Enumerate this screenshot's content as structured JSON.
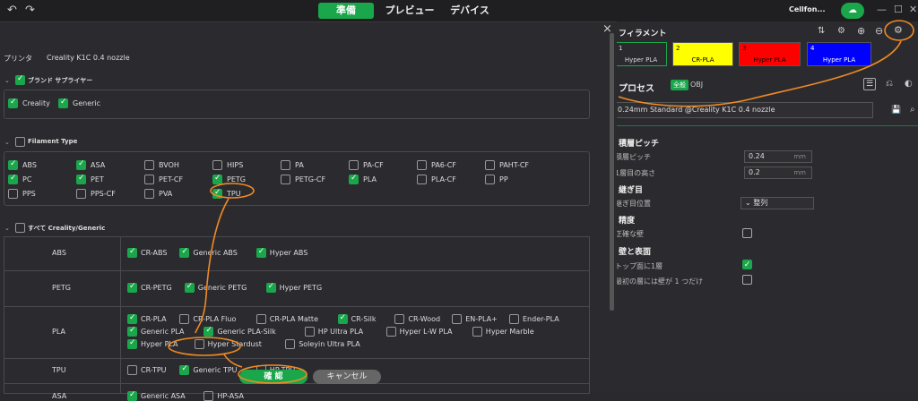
{
  "topbar": {
    "tabs": [
      "準備",
      "プレビュー",
      "デバイス"
    ],
    "user": "Cellfon..."
  },
  "right": {
    "filament_title": "フィラメント",
    "filaments": [
      {
        "num": "1",
        "name": "Hyper PLA",
        "color": "#2b2b2f"
      },
      {
        "num": "2",
        "name": "CR-PLA",
        "color": "#ffff00"
      },
      {
        "num": "3",
        "name": "Hyper PLA",
        "color": "#ff0000"
      },
      {
        "num": "4",
        "name": "Hyper PLA",
        "color": "#0000ff"
      }
    ],
    "process_title": "プロセス",
    "process_tag": "全般",
    "process_obj": "OBJ",
    "preset": "0.24mm Standard @Creality K1C 0.4 nozzle",
    "layer_pitch_title": "積層ピッチ",
    "layer_height_label": "積層ピッチ",
    "layer_height_value": "0.24",
    "first_layer_label": "1層目の高さ",
    "first_layer_value": "0.2",
    "unit": "mm",
    "seam_title": "継ぎ目",
    "seam_pos_label": "継ぎ目位置",
    "seam_pos_value": "整列",
    "precision_title": "精度",
    "precise_wall_label": "正確な壁",
    "walls_title": "壁と表面",
    "top_one_wall_label": "トップ面に1層",
    "first_layer_one_wall_label": "最初の層には壁が 1 つだけ"
  },
  "dialog": {
    "close": "×",
    "printer_label": "プリンタ",
    "printer_value": "Creality K1C 0.4 nozzle",
    "brand_title": "ブランド サプライヤー",
    "brands": [
      "Creality",
      "Generic"
    ],
    "type_title": "Filament Type",
    "types": [
      [
        "ABS",
        "ASA",
        "BVOH",
        "HIPS",
        "PA",
        "PA-CF",
        "PA6-CF",
        "PAHT-CF"
      ],
      [
        "PC",
        "PET",
        "PET-CF",
        "PETG",
        "PETG-CF",
        "PLA",
        "PLA-CF",
        "PP"
      ],
      [
        "PPS",
        "PPS-CF",
        "PVA",
        "TPU"
      ]
    ],
    "types_checked": [
      "ABS",
      "ASA",
      "PC",
      "PET",
      "PETG",
      "PLA",
      "TPU"
    ],
    "all_title": "すべて Creality/Generic",
    "groups": [
      {
        "name": "ABS",
        "items": [
          [
            "CR-ABS",
            true
          ],
          [
            "Generic ABS",
            true
          ],
          [
            "Hyper ABS",
            true
          ]
        ]
      },
      {
        "name": "PETG",
        "items": [
          [
            "CR-PETG",
            true
          ],
          [
            "Generic PETG",
            true
          ],
          [
            "Hyper PETG",
            true
          ]
        ]
      },
      {
        "name": "PLA",
        "items": [
          [
            "CR-PLA",
            true
          ],
          [
            "CR-PLA Fluo",
            false
          ],
          [
            "CR-PLA Matte",
            false
          ],
          [
            "CR-Silk",
            true
          ],
          [
            "CR-Wood",
            false
          ],
          [
            "EN-PLA+",
            false
          ],
          [
            "Ender-PLA",
            false
          ],
          [
            "Generic PLA",
            true
          ],
          [
            "Generic PLA-Silk",
            true
          ],
          [
            "HP Ultra PLA",
            false
          ],
          [
            "Hyper L-W PLA",
            false
          ],
          [
            "Hyper Marble",
            false
          ],
          [
            "Hyper PLA",
            true
          ],
          [
            "Hyper Stardust",
            false
          ],
          [
            "Soleyin Ultra PLA",
            false
          ]
        ]
      },
      {
        "name": "TPU",
        "items": [
          [
            "CR-TPU",
            false
          ],
          [
            "Generic TPU",
            true
          ],
          [
            "HP-TPU",
            false
          ]
        ]
      },
      {
        "name": "ASA",
        "items": [
          [
            "Generic ASA",
            true
          ],
          [
            "HP-ASA",
            false
          ]
        ]
      }
    ],
    "confirm": "確 認",
    "cancel": "キャンセル"
  },
  "colors": {
    "accent": "#1aa64a",
    "annotation": "#f08a24"
  }
}
